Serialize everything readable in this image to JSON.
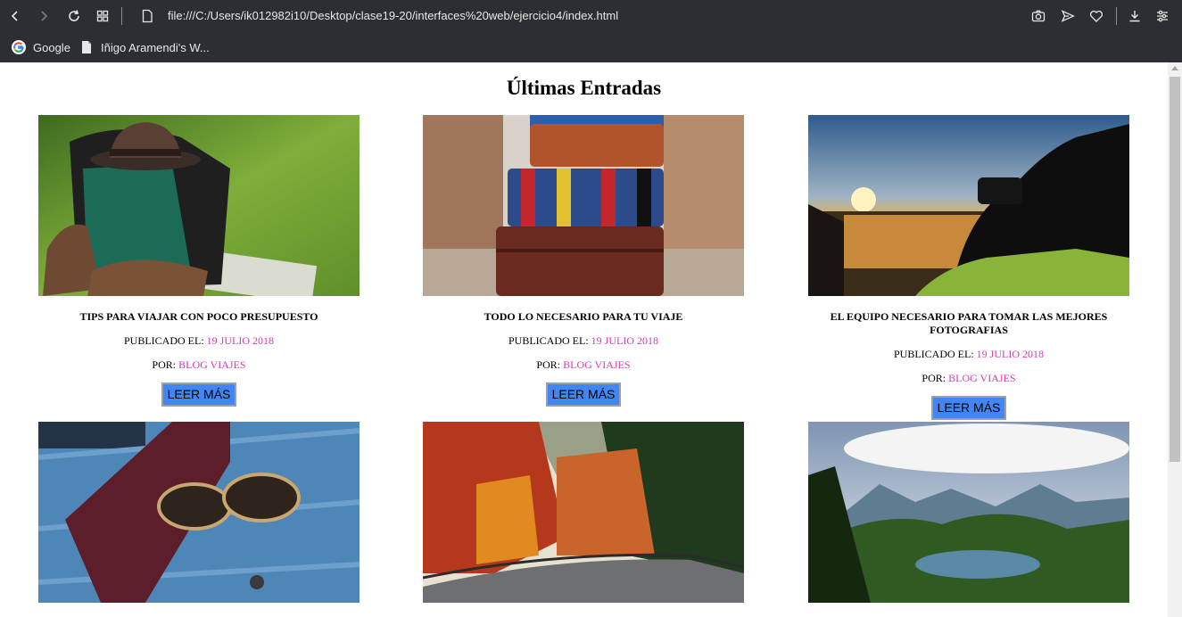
{
  "browser": {
    "url": "file:///C:/Users/ik012982i10/Desktop/clase19-20/interfaces%20web/ejercicio4/index.html",
    "bookmarks": [
      {
        "label": "Google",
        "icon": "google-icon"
      },
      {
        "label": "Iñigo Aramendi's W...",
        "icon": "page-icon"
      }
    ]
  },
  "page": {
    "title": "Últimas Entradas",
    "published_prefix": "PUBLICADO EL: ",
    "author_prefix": "POR: ",
    "button_label": "LEER MÁS"
  },
  "posts": [
    {
      "title": "TIPS PARA VIAJAR CON POCO PRESUPUESTO",
      "date": "19 JULIO 2018",
      "author": "BLOG VIAJES",
      "image": "backpack-hat-boots"
    },
    {
      "title": "TODO LO NECESARIO PARA TU VIAJE",
      "date": "19 JULIO 2018",
      "author": "BLOG VIAJES",
      "image": "stacked-suitcases"
    },
    {
      "title": "EL EQUIPO NECESARIO PARA TOMAR LAS MEJORES FOTOGRAFIAS",
      "date": "19 JULIO 2018",
      "author": "BLOG VIAJES",
      "image": "photographer-sunset"
    },
    {
      "title": "",
      "date": "",
      "author": "",
      "image": "passport-sunglasses"
    },
    {
      "title": "",
      "date": "",
      "author": "",
      "image": "autumn-road"
    },
    {
      "title": "",
      "date": "",
      "author": "",
      "image": "mountain-lake"
    }
  ],
  "colors": {
    "chrome": "#2b2e33",
    "link": "#d63ab3",
    "button": "#4285f4"
  }
}
